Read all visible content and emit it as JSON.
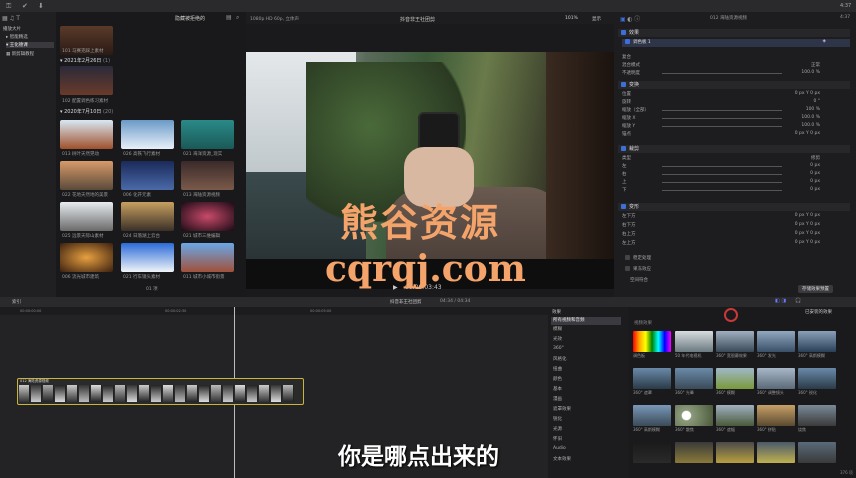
{
  "toolbar": {
    "left_icons": [
      "key-icon",
      "checkmark-icon",
      "import-icon"
    ],
    "right_time": "4:37"
  },
  "library": {
    "items": [
      {
        "label": "播放大片"
      },
      {
        "label": "智能精选"
      },
      {
        "label": "王化德课"
      },
      {
        "label": "新剪辑教程"
      }
    ]
  },
  "browser": {
    "header": "隐藏被拒绝的",
    "groups": [
      {
        "date": "2021年2月26日",
        "count": "(1)"
      },
      {
        "date": "2020年7月10日",
        "count": "(20)"
      }
    ],
    "top_captions": [
      "101 马赛克踩上素材",
      "102 配置调色练习素材"
    ],
    "captions": [
      "013 树叶天然晃动",
      "026 高铁飞行素材",
      "021 海洋资源_现实",
      "022 花地天然地的美景",
      "006 化开元素",
      "013 海陆资源视频",
      "025 远景天际山素材",
      "024 日落湖上云台",
      "021 城市三维编辑",
      "006 流光城市建筑",
      "021 行车镜头素材",
      "011 城市小城市街景"
    ],
    "footer": "01 项"
  },
  "viewer": {
    "format": "1080p HD 60p, 立体声",
    "title": "抖音非王社团剪",
    "zoom": "101%",
    "display": "显示",
    "timecode": "00:00:03:43"
  },
  "inspector": {
    "title": "012 海陆资源视频",
    "duration": "4:37",
    "effects_label": "效果",
    "effect_item": "调色板 1",
    "compositing": {
      "title": "复合",
      "blend_label": "混合模式",
      "blend_value": "正常",
      "opacity_label": "不透明度",
      "opacity_value": "100.0 %"
    },
    "transform": {
      "title": "变换",
      "rows": [
        {
          "label": "位置",
          "v": "0 px    Y    0 px"
        },
        {
          "label": "旋转",
          "v": "0 °"
        },
        {
          "label": "缩放（全部）",
          "v": "100 %"
        },
        {
          "label": "缩放 X",
          "v": "100.0 %"
        },
        {
          "label": "缩放 Y",
          "v": "100.0 %"
        },
        {
          "label": "锚点",
          "v": "0 px    Y    0 px"
        }
      ]
    },
    "crop": {
      "title": "裁剪",
      "type_label": "类型",
      "type_value": "修剪",
      "rows": [
        {
          "label": "左",
          "v": "0 px"
        },
        {
          "label": "右",
          "v": "0 px"
        },
        {
          "label": "上",
          "v": "0 px"
        },
        {
          "label": "下",
          "v": "0 px"
        }
      ]
    },
    "distort": {
      "title": "变形",
      "rows": [
        {
          "label": "左下方",
          "v": "0 px    Y    0 px"
        },
        {
          "label": "右下方",
          "v": "0 px    Y    0 px"
        },
        {
          "label": "右上方",
          "v": "0 px    Y    0 px"
        },
        {
          "label": "左上方",
          "v": "0 px    Y    0 px"
        }
      ]
    },
    "extras": [
      "稳定处理",
      "果冻效应",
      "空间符合"
    ],
    "save_button": "存储效果预置"
  },
  "timeline": {
    "index_label": "索引",
    "project": "抖音非王社团剪",
    "duration": "04:34 / 04:34",
    "clip_name": "012 海陆资源视频",
    "ruler": [
      "00:00:00:00",
      "00:00:02:30",
      "00:00:05:00"
    ]
  },
  "effects": {
    "header": "效果",
    "installed": "已安装的效果",
    "section": "视频效果",
    "categories": [
      "所有视频和音频",
      "模糊",
      "光效",
      "360°",
      "风格化",
      "扭曲",
      "颜色",
      "基本",
      "漫画",
      "遮罩效果",
      "锐化",
      "光源",
      "怀旧",
      "Audio",
      "文本效果",
      "平铺",
      "颜色预置"
    ],
    "items": [
      "调色板",
      "50 年代电视机",
      "360° 宽银幕效果",
      "360° 发光",
      "360° 高斯模糊",
      "360° 遮罩",
      "360° 光晕",
      "360° 模糊",
      "360° 调整镜头",
      "360° 锐化",
      "360° 高斯模糊",
      "360° 散焦",
      "360° 遮幅",
      "360° 拼贴",
      "烧焦",
      "",
      "",
      "",
      "",
      ""
    ],
    "count": "376 项"
  },
  "overlay": {
    "watermark_cn": "熊谷资源",
    "watermark_url": "cqrqj.com",
    "subtitle": "你是哪点出来的"
  },
  "colors": {
    "accent": "#3c6fd8",
    "watermark": "#f4a46b",
    "clip_border": "#c9b53a",
    "bg": "#1a1a1c"
  }
}
